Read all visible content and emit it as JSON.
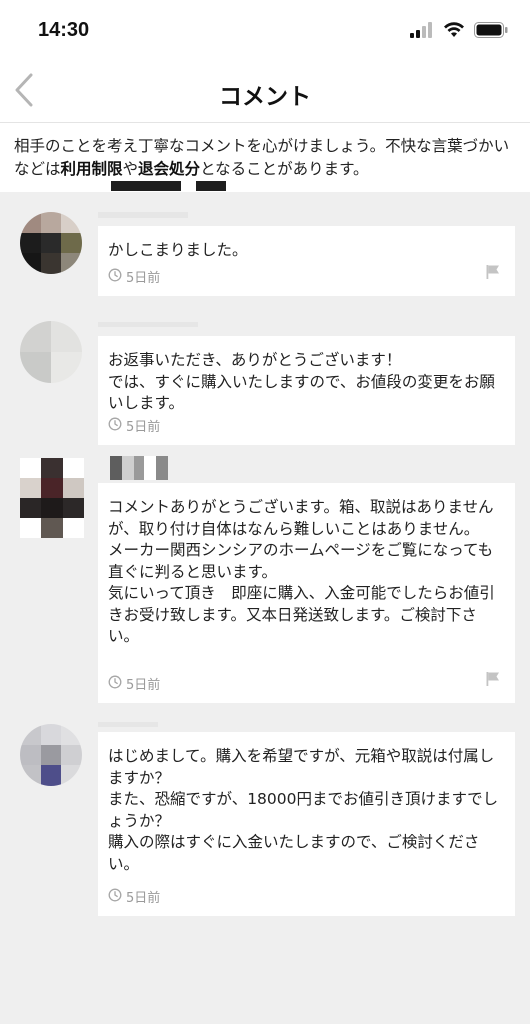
{
  "status_bar": {
    "time": "14:30"
  },
  "nav": {
    "title": "コメント"
  },
  "notice": {
    "text_before": "相手のことを考え丁寧なコメントを心がけましょう。不快な言葉づかいなどは",
    "link1": "利用制限",
    "text_middle": "や",
    "link2": "退会処分",
    "text_after": "となることがあります。"
  },
  "comments": [
    {
      "text": "かしこまりました。",
      "time": "5日前",
      "flag_visible": true
    },
    {
      "text": "お返事いただき、ありがとうございます！\nでは、すぐに購入いたしますので、お値段の変更をお願いします。",
      "time": "5日前",
      "flag_visible": false
    },
    {
      "text": "コメントありがとうございます。箱、取説はありませんが、取り付け自体はなんら難しいことはありません。\nメーカー関西シンシアのホームページをご覧になっても直ぐに判ると思います。\n気にいって頂き　即座に購入、入金可能でしたらお値引きお受け致します。又本日発送致します。ご検討下さい。",
      "time": "5日前",
      "flag_visible": true
    },
    {
      "text": "はじめまして。購入を希望ですが、元箱や取説は付属しますか？\nまた、恐縮ですが、18000円までお値引き頂けますでしょうか？\n購入の際はすぐに入金いたしますので、ご検討ください。",
      "time": "5日前",
      "flag_visible": false
    }
  ],
  "icons": {
    "back": "chevron-left-icon",
    "clock": "clock-icon",
    "flag": "flag-icon",
    "signal": "cellular-signal-icon",
    "wifi": "wifi-icon",
    "battery": "battery-icon"
  },
  "colors": {
    "background": "#efefef",
    "bubble": "#ffffff",
    "meta_text": "#9a9a9a"
  }
}
